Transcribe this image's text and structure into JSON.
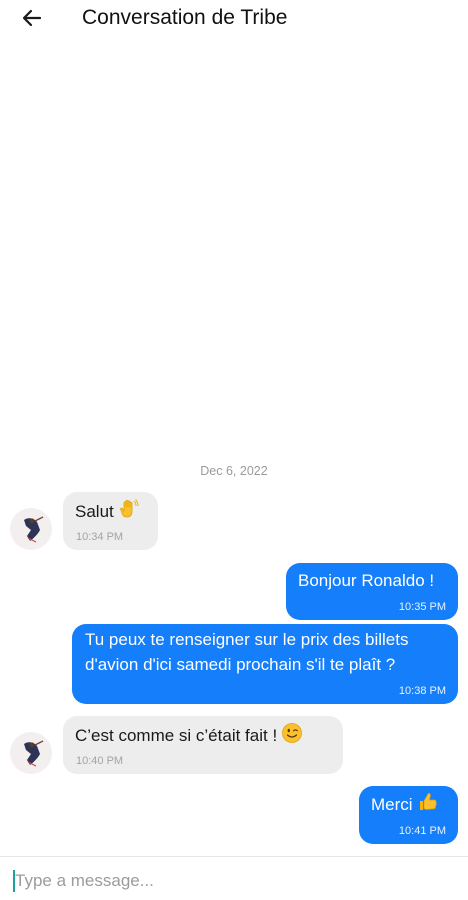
{
  "header": {
    "title": "Conversation de Tribe",
    "back_icon": "arrow-left-icon"
  },
  "date_separator": "Dec 6, 2022",
  "messages": [
    {
      "direction": "incoming",
      "text": "Salut",
      "emoji": "waving-hand-icon",
      "time": "10:34 PM"
    },
    {
      "direction": "outgoing",
      "text": "Bonjour Ronaldo !",
      "time": "10:35 PM"
    },
    {
      "direction": "outgoing",
      "lines": [
        "Tu peux te renseigner sur le prix des billets",
        "d'avion d'ici samedi prochain s'il te plaît ?"
      ],
      "time": "10:38 PM"
    },
    {
      "direction": "incoming",
      "text": "C’est comme si c’était fait !",
      "emoji": "winking-face-icon",
      "time": "10:40 PM"
    },
    {
      "direction": "outgoing",
      "text": "Merci",
      "emoji": "thumbs-up-icon",
      "time": "10:41 PM"
    }
  ],
  "composer": {
    "placeholder": "Type a message...",
    "value": ""
  },
  "colors": {
    "outgoing_bubble": "#147efb",
    "incoming_bubble": "#ededed",
    "background": "#ffffff"
  }
}
